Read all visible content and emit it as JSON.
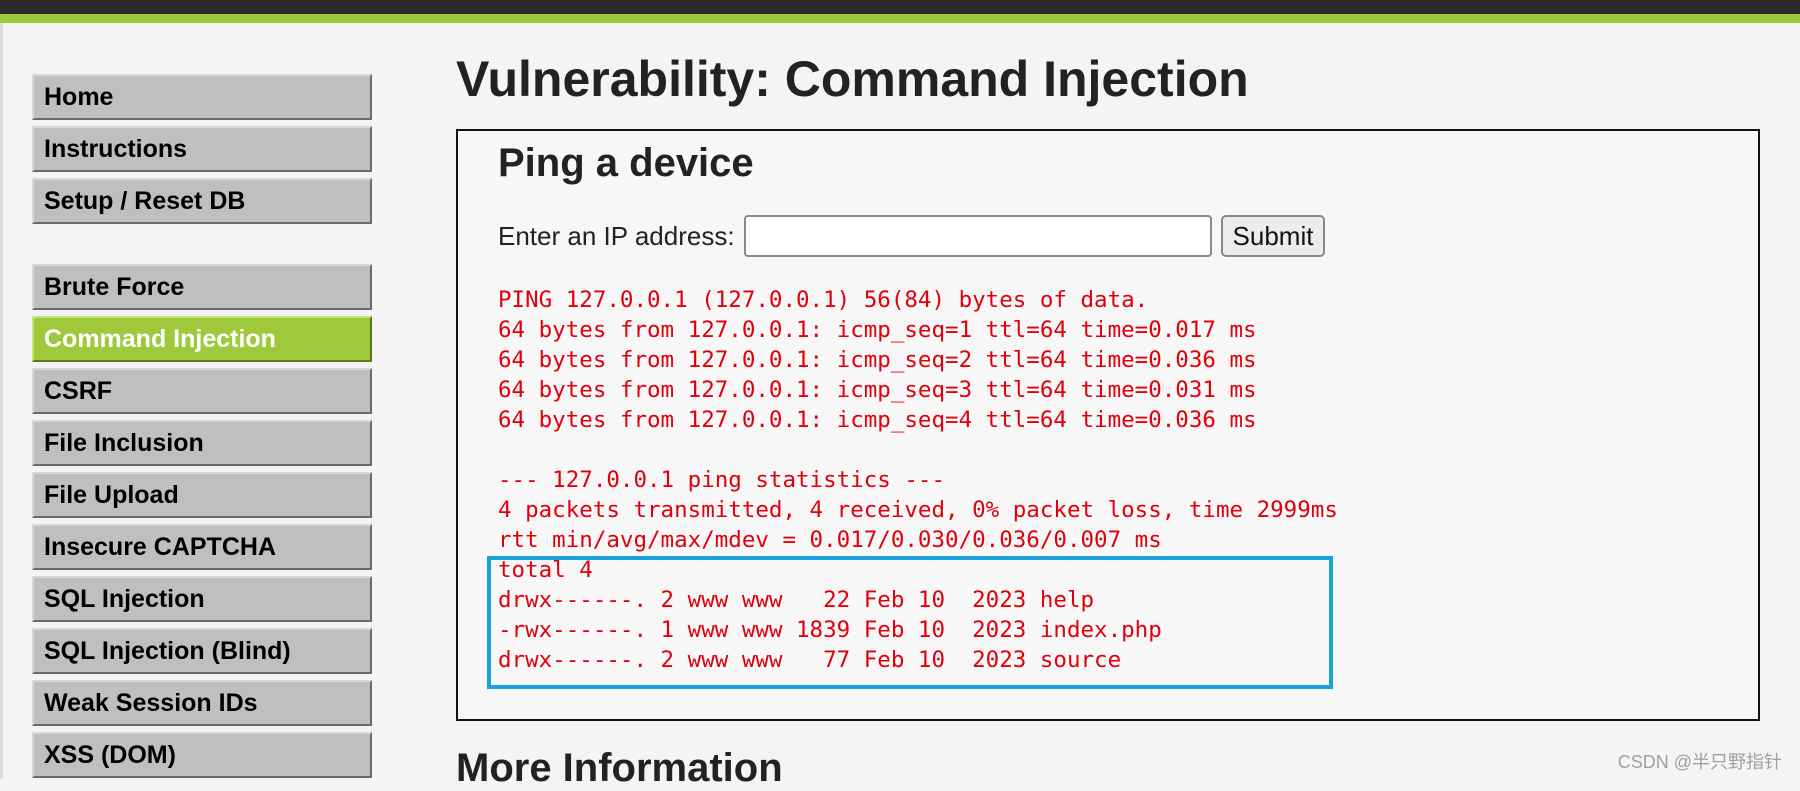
{
  "sidebar": {
    "group1": [
      {
        "label": "Home"
      },
      {
        "label": "Instructions"
      },
      {
        "label": "Setup / Reset DB"
      }
    ],
    "group2": [
      {
        "label": "Brute Force"
      },
      {
        "label": "Command Injection"
      },
      {
        "label": "CSRF"
      },
      {
        "label": "File Inclusion"
      },
      {
        "label": "File Upload"
      },
      {
        "label": "Insecure CAPTCHA"
      },
      {
        "label": "SQL Injection"
      },
      {
        "label": "SQL Injection (Blind)"
      },
      {
        "label": "Weak Session IDs"
      },
      {
        "label": "XSS (DOM)"
      }
    ],
    "active_item": "Command Injection"
  },
  "main": {
    "title": "Vulnerability: Command Injection",
    "panel_title": "Ping a device",
    "ip_label": "Enter an IP address:",
    "ip_input": {
      "value": "",
      "placeholder": ""
    },
    "submit_label": "Submit",
    "output_lines": [
      "PING 127.0.0.1 (127.0.0.1) 56(84) bytes of data.",
      "64 bytes from 127.0.0.1: icmp_seq=1 ttl=64 time=0.017 ms",
      "64 bytes from 127.0.0.1: icmp_seq=2 ttl=64 time=0.036 ms",
      "64 bytes from 127.0.0.1: icmp_seq=3 ttl=64 time=0.031 ms",
      "64 bytes from 127.0.0.1: icmp_seq=4 ttl=64 time=0.036 ms",
      "",
      "--- 127.0.0.1 ping statistics ---",
      "4 packets transmitted, 4 received, 0% packet loss, time 2999ms",
      "rtt min/avg/max/mdev = 0.017/0.030/0.036/0.007 ms",
      "total 4",
      "drwx------. 2 www www   22 Feb 10  2023 help",
      "-rwx------. 1 www www 1839 Feb 10  2023 index.php",
      "drwx------. 2 www www   77 Feb 10  2023 source"
    ],
    "more_info_heading": "More Information"
  },
  "watermark": "CSDN @半只野指针",
  "colors": {
    "topbar": "#2b2b2b",
    "accent_green": "#9ec93a",
    "menu_gray": "#bfbfbf",
    "output_red": "#e0000c",
    "highlight_blue": "#1aa2dc"
  }
}
